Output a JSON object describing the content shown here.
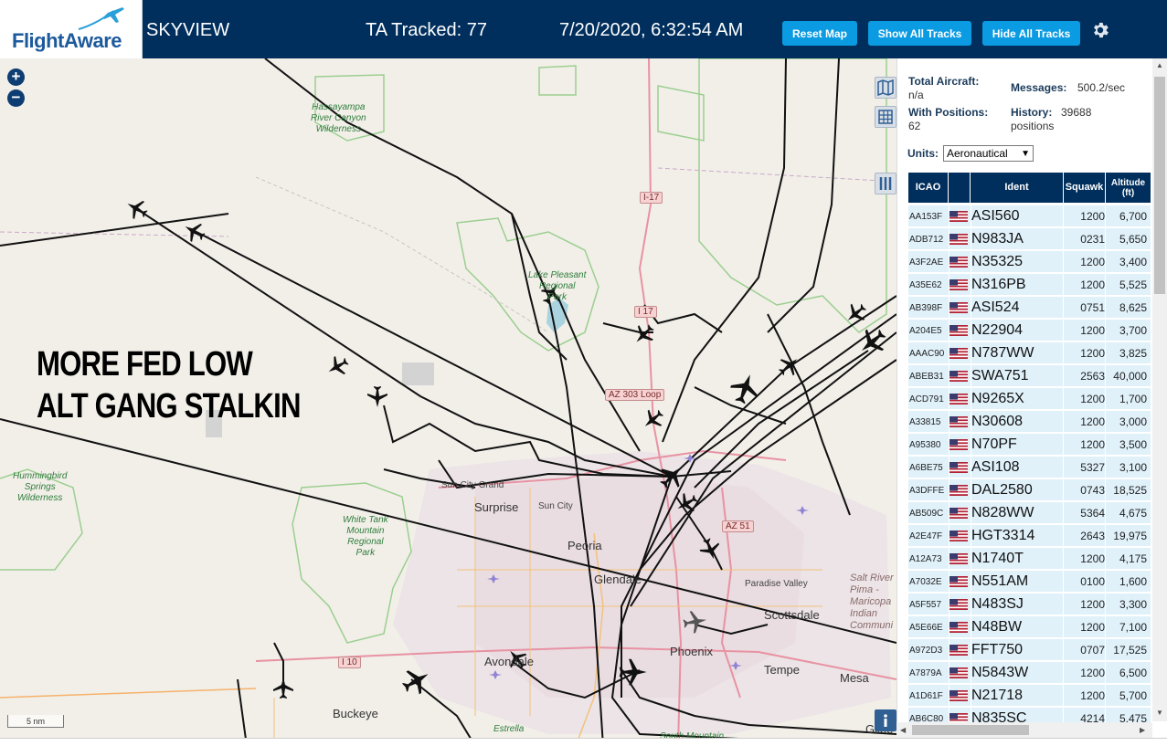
{
  "header": {
    "logo_text": "FlightAware",
    "app_title": "SKYVIEW",
    "ta_tracked": "TA Tracked: 77",
    "datetime": "7/20/2020, 6:32:54 AM",
    "buttons": {
      "reset": "Reset Map",
      "show_all": "Show All Tracks",
      "hide_all": "Hide All Tracks"
    },
    "settings_icon": "gear-icon",
    "colors": {
      "bar": "#002f5d",
      "button": "#0b9be2",
      "logo": "#1d5a9c"
    }
  },
  "map": {
    "overlay_text": [
      "MORE FED LOW",
      "ALT GANG STALKIN"
    ],
    "scale_label": "5 nm",
    "places": [
      "Surprise",
      "Sun City",
      "Sun City Grand",
      "Peoria",
      "Glendale",
      "Phoenix",
      "Scottsdale",
      "Paradise Valley",
      "Tempe",
      "Mesa",
      "Avondale",
      "Buckeye",
      "Gilbe",
      "Estrella",
      "South Mountain"
    ],
    "parks": {
      "hassayampa": [
        "Hassayampa",
        "River Canyon",
        "Wilderness"
      ],
      "hummingbird": [
        "Hummingbird",
        "Springs",
        "Wilderness"
      ],
      "white_tank": [
        "White Tank",
        "Mountain",
        "Regional",
        "Park"
      ],
      "lake_pleasant": [
        "Lake Pleasant",
        "Regional",
        "Park"
      ],
      "salt_river": [
        "Salt River",
        "Pima -",
        "Maricopa",
        "Indian",
        "Communi"
      ]
    },
    "road_shields": [
      "I-17",
      "I 17",
      "AZ 303 Loop",
      "AZ 51",
      "I 10"
    ],
    "controls": [
      "zoom-in",
      "zoom-out",
      "map-layers",
      "grid",
      "columns",
      "info"
    ]
  },
  "panel": {
    "stats": {
      "total_aircraft_label": "Total Aircraft:",
      "total_aircraft_value": "n/a",
      "messages_label": "Messages:",
      "messages_value": "500.2/sec",
      "with_positions_label": "With Positions:",
      "with_positions_value": "62",
      "history_label": "History:",
      "history_value": "39688",
      "history_unit": "positions"
    },
    "units_label": "Units:",
    "units_selected": "Aeronautical",
    "columns": [
      "ICAO",
      "",
      "Ident",
      "Squawk",
      "Altitude (ft)"
    ],
    "rows": [
      {
        "icao": "AA153F",
        "ident": "ASI560",
        "squawk": "1200",
        "alt": "6,700"
      },
      {
        "icao": "ADB712",
        "ident": "N983JA",
        "squawk": "0231",
        "alt": "5,650"
      },
      {
        "icao": "A3F2AE",
        "ident": "N35325",
        "squawk": "1200",
        "alt": "3,400"
      },
      {
        "icao": "A35E62",
        "ident": "N316PB",
        "squawk": "1200",
        "alt": "5,525"
      },
      {
        "icao": "AB398F",
        "ident": "ASI524",
        "squawk": "0751",
        "alt": "8,625"
      },
      {
        "icao": "A204E5",
        "ident": "N22904",
        "squawk": "1200",
        "alt": "3,700"
      },
      {
        "icao": "AAAC90",
        "ident": "N787WW",
        "squawk": "1200",
        "alt": "3,825"
      },
      {
        "icao": "ABEB31",
        "ident": "SWA751",
        "squawk": "2563",
        "alt": "40,000"
      },
      {
        "icao": "ACD791",
        "ident": "N9265X",
        "squawk": "1200",
        "alt": "1,700"
      },
      {
        "icao": "A33815",
        "ident": "N30608",
        "squawk": "1200",
        "alt": "3,000"
      },
      {
        "icao": "A95380",
        "ident": "N70PF",
        "squawk": "1200",
        "alt": "3,500"
      },
      {
        "icao": "A6BE75",
        "ident": "ASI108",
        "squawk": "5327",
        "alt": "3,100"
      },
      {
        "icao": "A3DFFE",
        "ident": "DAL2580",
        "squawk": "0743",
        "alt": "18,525"
      },
      {
        "icao": "AB509C",
        "ident": "N828WW",
        "squawk": "5364",
        "alt": "4,675"
      },
      {
        "icao": "A2E47F",
        "ident": "HGT3314",
        "squawk": "2643",
        "alt": "19,975"
      },
      {
        "icao": "A12A73",
        "ident": "N1740T",
        "squawk": "1200",
        "alt": "4,175"
      },
      {
        "icao": "A7032E",
        "ident": "N551AM",
        "squawk": "0100",
        "alt": "1,600"
      },
      {
        "icao": "A5F557",
        "ident": "N483SJ",
        "squawk": "1200",
        "alt": "3,300"
      },
      {
        "icao": "A5E66E",
        "ident": "N48BW",
        "squawk": "1200",
        "alt": "7,100"
      },
      {
        "icao": "A972D3",
        "ident": "FFT750",
        "squawk": "0707",
        "alt": "17,525"
      },
      {
        "icao": "A7879A",
        "ident": "N5843W",
        "squawk": "1200",
        "alt": "6,500"
      },
      {
        "icao": "A1D61F",
        "ident": "N21718",
        "squawk": "1200",
        "alt": "5,700"
      },
      {
        "icao": "AB6C80",
        "ident": "N835SC",
        "squawk": "4214",
        "alt": "5,475"
      }
    ],
    "row_color": "#e0f1fa",
    "header_color": "#002f5d"
  }
}
